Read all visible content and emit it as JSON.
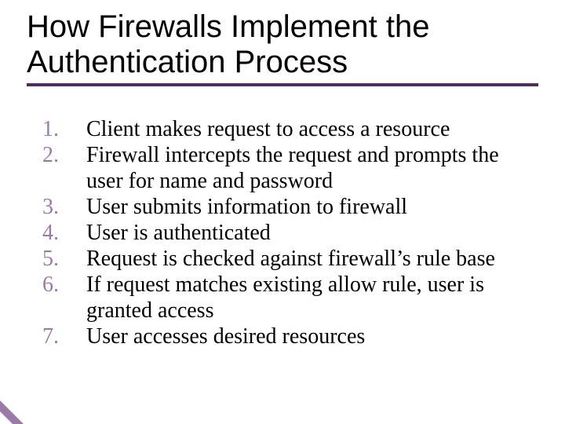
{
  "title": "How Firewalls Implement the Authentication Process",
  "items": [
    "Client makes request to access a resource",
    "Firewall intercepts the request and prompts the user for name and password",
    "User submits information to firewall",
    "User is authenticated",
    "Request is checked against firewall’s rule base",
    "If request matches existing allow rule, user is granted access",
    "User accesses desired resources"
  ]
}
